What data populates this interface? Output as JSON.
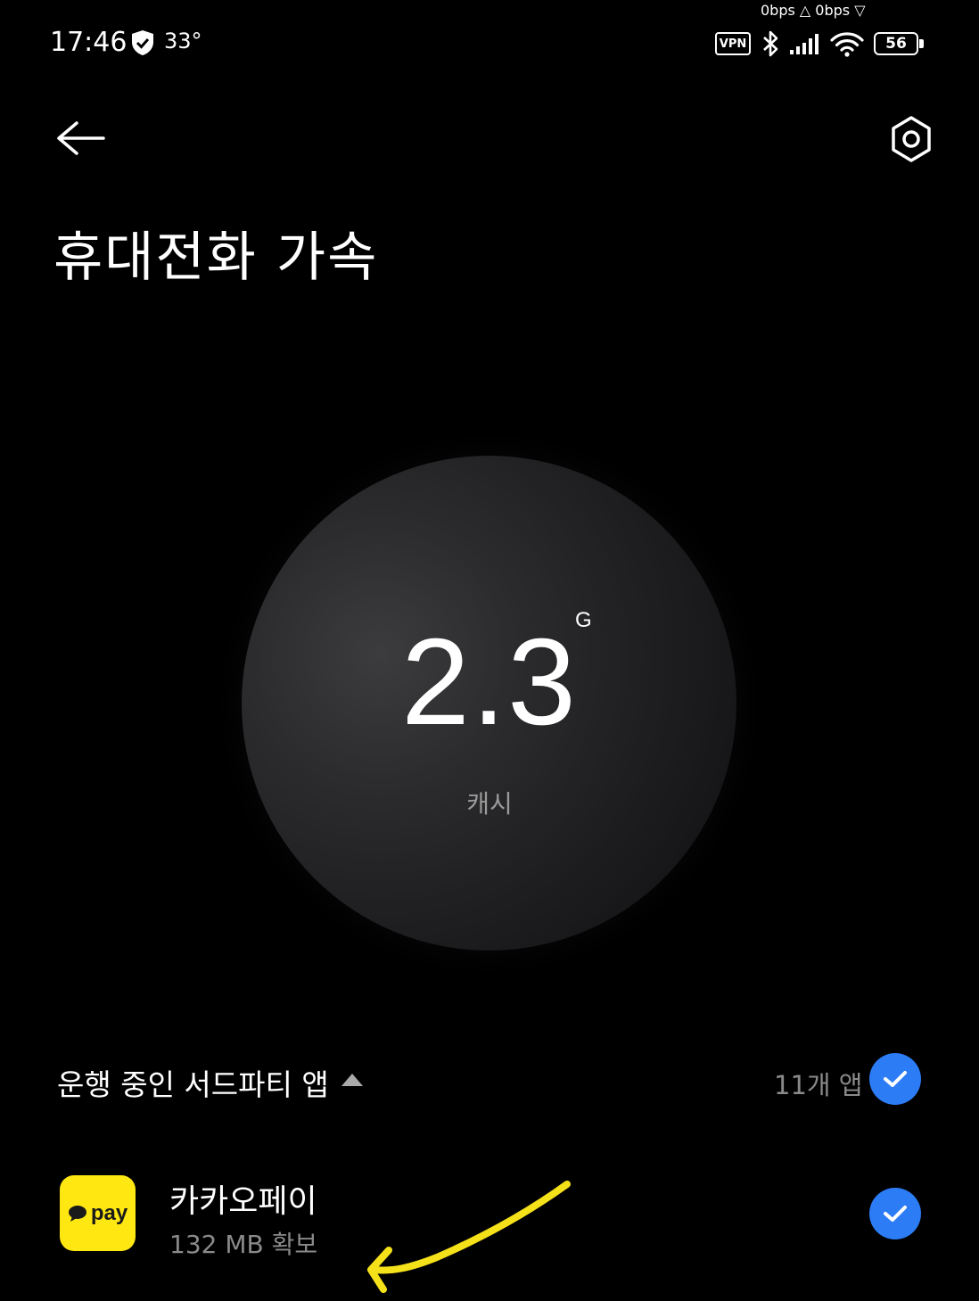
{
  "status_bar": {
    "time": "17:46",
    "temperature": "33°",
    "network_speed": "0bps △ 0bps ▽",
    "vpn_label": "VPN",
    "battery_level": "56",
    "icons": [
      "shield-check-icon",
      "vpn-icon",
      "bluetooth-icon",
      "cell-signal-icon",
      "wifi-icon",
      "battery-icon"
    ]
  },
  "toolbar": {
    "back_icon": "arrow-left-icon",
    "settings_icon": "hexagon-settings-icon"
  },
  "page": {
    "title": "휴대전화 가속"
  },
  "cache": {
    "value": "2.3",
    "unit": "G",
    "label": "캐시"
  },
  "section": {
    "title": "운행 중인 서드파티 앱",
    "count": "11개 앱",
    "select_all_checked": true
  },
  "apps": [
    {
      "name": "카카오페이",
      "icon_text": "pay",
      "freed": "132 MB 확보",
      "checked": true
    }
  ],
  "colors": {
    "accent_blue": "#2c7cf6",
    "kakao_yellow": "#ffe812",
    "annotation_yellow": "#f5e11a",
    "background": "#000000"
  }
}
